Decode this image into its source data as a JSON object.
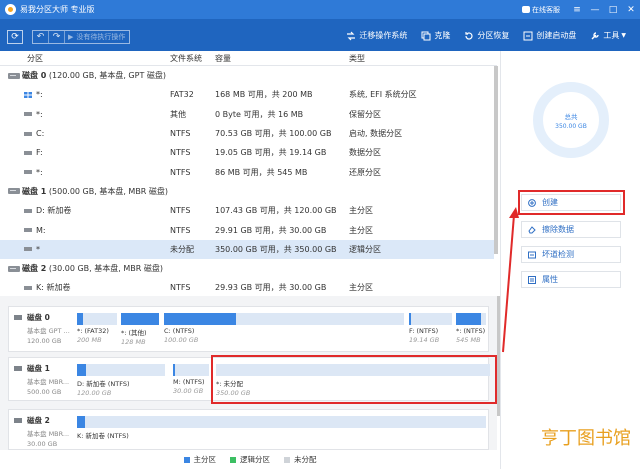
{
  "app": {
    "title": "易我分区大师 专业版",
    "chat_label": "在线客服"
  },
  "toolbar": {
    "execute_label": "没有待执行操作",
    "items": [
      {
        "label": "迁移操作系统",
        "icon": "migrate-os-icon"
      },
      {
        "label": "克隆",
        "icon": "clone-icon"
      },
      {
        "label": "分区恢复",
        "icon": "partition-recovery-icon"
      },
      {
        "label": "创建启动盘",
        "icon": "boot-disk-icon"
      },
      {
        "label": "工具",
        "icon": "tools-icon"
      }
    ]
  },
  "table": {
    "headers": {
      "name": "分区",
      "fs": "文件系统",
      "capacity": "容量",
      "type": "类型"
    },
    "rows": [
      {
        "kind": "disk",
        "label": "磁盘 0",
        "detail": " (120.00 GB, 基本盘, GPT 磁盘)"
      },
      {
        "kind": "part",
        "name": "*:",
        "fs": "FAT32",
        "capacity": "168 MB   可用，共  200 MB",
        "type": "系统, EFI 系统分区"
      },
      {
        "kind": "part",
        "name": "*:",
        "fs": "其他",
        "capacity": "0 Byte   可用，共  16 MB",
        "type": "保留分区"
      },
      {
        "kind": "part",
        "name": "C:",
        "fs": "NTFS",
        "capacity": "70.53 GB  可用，共  100.00 GB",
        "type": "启动, 数据分区"
      },
      {
        "kind": "part",
        "name": "F:",
        "fs": "NTFS",
        "capacity": "19.05 GB  可用，共  19.14 GB",
        "type": "数据分区"
      },
      {
        "kind": "part",
        "name": "*:",
        "fs": "NTFS",
        "capacity": "86 MB   可用，共  545 MB",
        "type": "还原分区"
      },
      {
        "kind": "disk",
        "label": "磁盘 1",
        "detail": " (500.00 GB, 基本盘, MBR 磁盘)"
      },
      {
        "kind": "part",
        "name": "D: 新加卷",
        "fs": "NTFS",
        "capacity": "107.43 GB 可用，共  120.00 GB",
        "type": "主分区"
      },
      {
        "kind": "part",
        "name": "M:",
        "fs": "NTFS",
        "capacity": "29.91 GB  可用，共  30.00 GB",
        "type": "主分区"
      },
      {
        "kind": "part",
        "name": "*",
        "fs": "未分配",
        "capacity": "350.00 GB 可用，共  350.00 GB",
        "type": "逻辑分区",
        "selected": true
      },
      {
        "kind": "disk",
        "label": "磁盘 2",
        "detail": " (30.00 GB, 基本盘, MBR 磁盘)"
      },
      {
        "kind": "part",
        "name": "K: 新加卷",
        "fs": "NTFS",
        "capacity": "29.93 GB  可用，共  30.00 GB",
        "type": "主分区"
      }
    ]
  },
  "diskmap": {
    "disk0": {
      "name": "磁盘 0",
      "type": "基本盘 GPT ...",
      "size": "120.00 GB",
      "segments": [
        {
          "label": "*: (FAT32)",
          "size": "200 MB",
          "used": 0.16
        },
        {
          "label": "*: (其他)",
          "size": "128 MB",
          "used": 1.0
        },
        {
          "label": "C: (NTFS)",
          "size": "100.00 GB",
          "used": 0.3
        },
        {
          "label": "F: (NTFS)",
          "size": "19.14 GB",
          "used": 0.05
        },
        {
          "label": "*: (NTFS)",
          "size": "545 MB",
          "used": 0.84
        }
      ]
    },
    "disk1": {
      "name": "磁盘 1",
      "type": "基本盘 MBR...",
      "size": "500.00 GB",
      "segments": [
        {
          "label": "D: 新加卷 (NTFS)",
          "size": "120.00 GB",
          "used": 0.1
        },
        {
          "label": "M: (NTFS)",
          "size": "30.00 GB",
          "used": 0.06
        },
        {
          "label": "*: 未分配",
          "size": "350.00 GB",
          "used": 0
        }
      ]
    },
    "disk2": {
      "name": "磁盘 2",
      "type": "基本盘 MBR...",
      "size": "30.00 GB",
      "segments": [
        {
          "label": "K: 新加卷 (NTFS)",
          "size": "30.00 GB",
          "used": 0.02
        }
      ]
    }
  },
  "legend": [
    {
      "label": "主分区",
      "color": "#3b86e3"
    },
    {
      "label": "逻辑分区",
      "color": "#3cbf63"
    },
    {
      "label": "未分配",
      "color": "#cfd3d8"
    }
  ],
  "panel": {
    "total_label": "总共",
    "total_value": "350.00 GB",
    "actions": [
      {
        "label": "创建",
        "icon": "plus-circle-icon"
      },
      {
        "label": "擦除数据",
        "icon": "eraser-icon"
      },
      {
        "label": "坏道检测",
        "icon": "surface-test-icon"
      },
      {
        "label": "属性",
        "icon": "properties-icon"
      }
    ]
  },
  "watermark": {
    "part1": "Y",
    "part2": "T",
    "text": ""
  },
  "watermark_text": "亨丁图书馆",
  "colors": {
    "primary": "#3b86e3",
    "titlebar": "#2f7ad7",
    "toolbar": "#1f65bf",
    "highlight": "#e02a2a"
  }
}
